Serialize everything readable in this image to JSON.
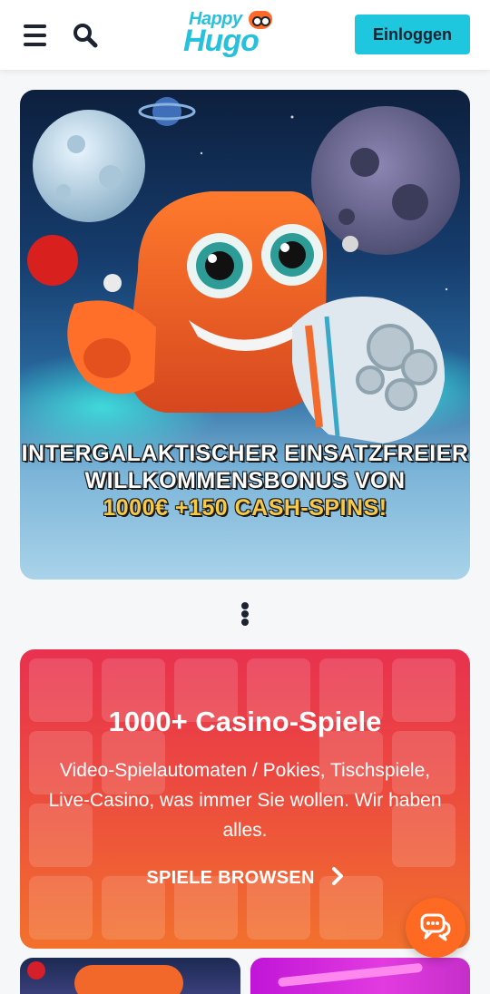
{
  "header": {
    "menu_icon": "hamburger-menu-icon",
    "search_icon": "search-icon",
    "logo": {
      "top": "Happy",
      "bottom": "Hugo"
    },
    "login_label": "Einloggen",
    "accent_color": "#1ec6de"
  },
  "banner": {
    "lines": [
      "INTERGALAKTISCHER EINSATZFREIER",
      "WILLKOMMENSBONUS VON",
      "1000€ +150 CASH-SPINS!"
    ]
  },
  "pagination": {
    "icon": "more-dots-icon"
  },
  "promo": {
    "title": "1000+ Casino-Spiele",
    "description": "Video-Spielautomaten / Pokies, Tischspiele, Live-Casino, was immer Sie wollen. Wir haben alles.",
    "link_label": "SPIELE BROWSEN",
    "link_icon": "chevron-right-icon"
  },
  "chat": {
    "icon": "chat-bubbles-icon",
    "color": "#ff6a22"
  }
}
